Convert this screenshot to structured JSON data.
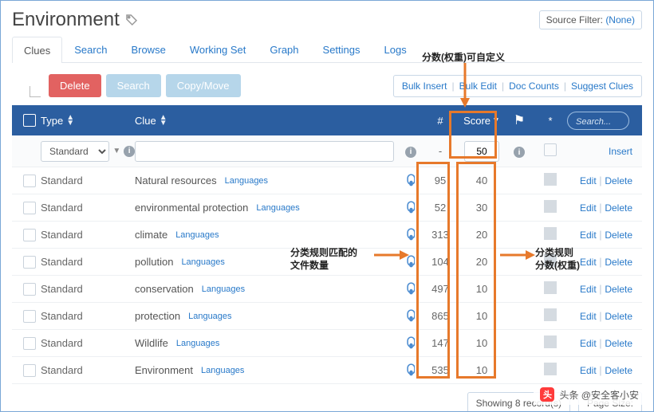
{
  "title": "Environment",
  "sourceFilter": {
    "label": "Source Filter:",
    "value": "(None)"
  },
  "tabs": [
    "Clues",
    "Search",
    "Browse",
    "Working Set",
    "Graph",
    "Settings",
    "Logs"
  ],
  "activeTab": 0,
  "annotations": {
    "scoreCustom": "分数(权重)可自定义",
    "matchCountA": "分类规则匹配的",
    "matchCountB": "文件数量",
    "ruleScoreA": "分类规则",
    "ruleScoreB": "分数(权重)"
  },
  "toolbar": {
    "delete": "Delete",
    "search": "Search",
    "copyMove": "Copy/Move",
    "links": [
      "Bulk Insert",
      "Bulk Edit",
      "Doc Counts",
      "Suggest Clues"
    ]
  },
  "columns": {
    "type": "Type",
    "clue": "Clue",
    "hash": "#",
    "score": "Score",
    "asterisk": "*",
    "searchPlaceholder": "Search..."
  },
  "insertRow": {
    "typeOption": "Standard",
    "hash": "-",
    "score": "50",
    "action": "Insert"
  },
  "rows": [
    {
      "type": "Standard",
      "clue": "Natural resources",
      "lang": "Languages",
      "num": 95,
      "score": 40
    },
    {
      "type": "Standard",
      "clue": "environmental protection",
      "lang": "Languages",
      "num": 52,
      "score": 30
    },
    {
      "type": "Standard",
      "clue": "climate",
      "lang": "Languages",
      "num": 313,
      "score": 20
    },
    {
      "type": "Standard",
      "clue": "pollution",
      "lang": "Languages",
      "num": 104,
      "score": 20
    },
    {
      "type": "Standard",
      "clue": "conservation",
      "lang": "Languages",
      "num": 497,
      "score": 10
    },
    {
      "type": "Standard",
      "clue": "protection",
      "lang": "Languages",
      "num": 865,
      "score": 10
    },
    {
      "type": "Standard",
      "clue": "Wildlife",
      "lang": "Languages",
      "num": 147,
      "score": 10
    },
    {
      "type": "Standard",
      "clue": "Environment",
      "lang": "Languages",
      "num": 535,
      "score": 10
    }
  ],
  "rowActions": {
    "edit": "Edit",
    "delete": "Delete"
  },
  "footer": {
    "showing": "Showing 8 record(s)",
    "pageSize": "Page Size:"
  },
  "watermark": "头条 @安全客小安"
}
